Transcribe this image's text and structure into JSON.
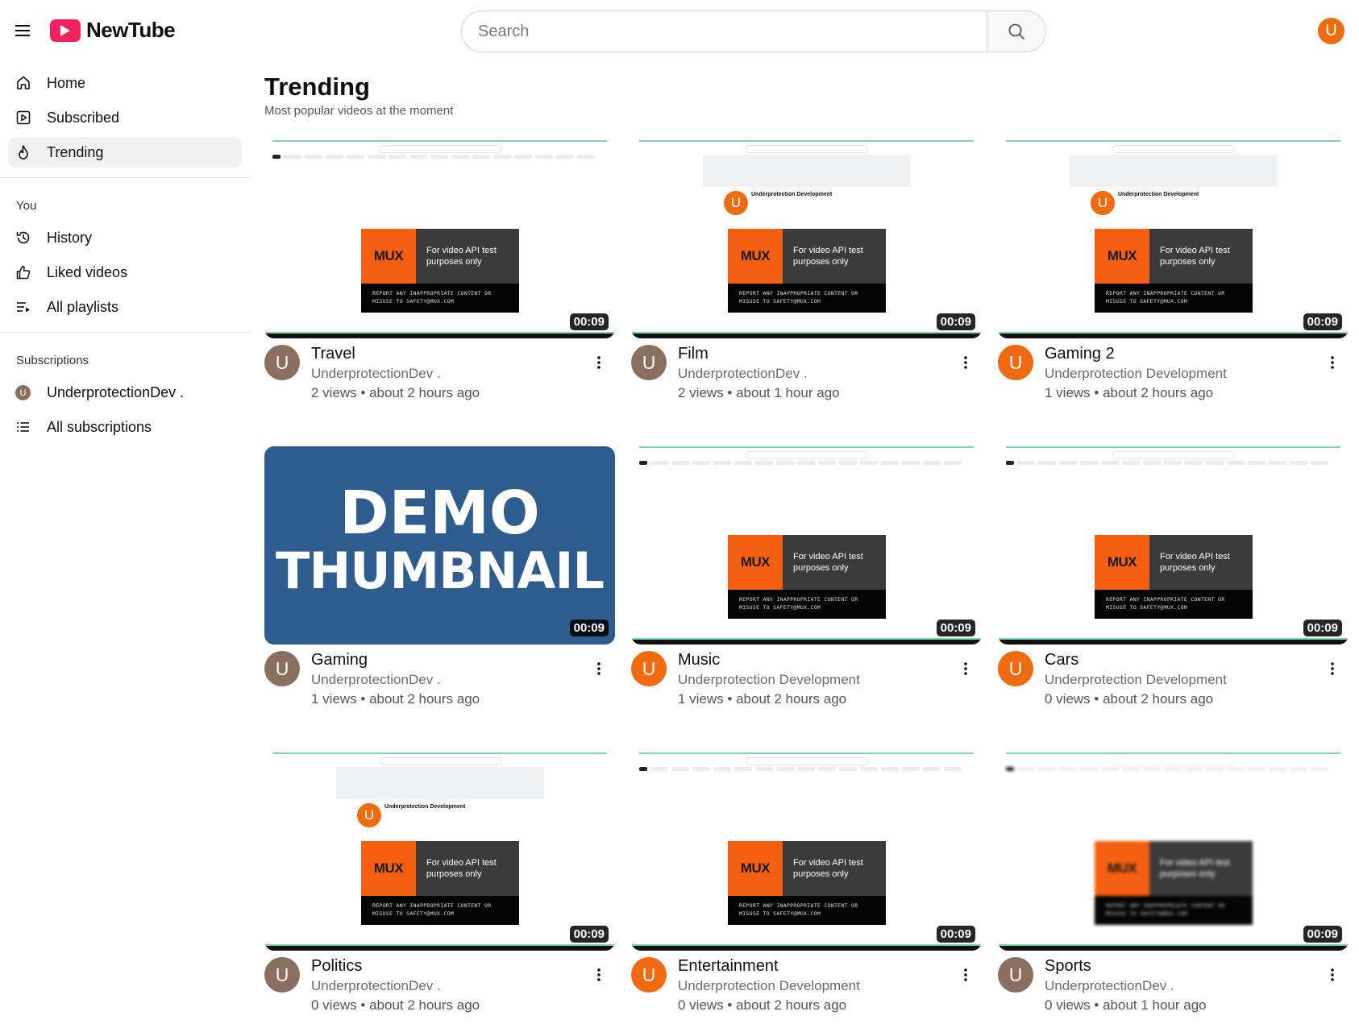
{
  "app": {
    "name": "NewTube"
  },
  "search": {
    "placeholder": "Search"
  },
  "user": {
    "avatar_letter": "U"
  },
  "sidebar": {
    "main": [
      {
        "label": "Home",
        "icon": "home-icon",
        "active": false
      },
      {
        "label": "Subscribed",
        "icon": "play-square-icon",
        "active": false
      },
      {
        "label": "Trending",
        "icon": "flame-icon",
        "active": true
      }
    ],
    "you_title": "You",
    "you": [
      {
        "label": "History",
        "icon": "history-icon"
      },
      {
        "label": "Liked videos",
        "icon": "thumbs-up-icon"
      },
      {
        "label": "All playlists",
        "icon": "playlist-icon"
      }
    ],
    "subs_title": "Subscriptions",
    "subs": [
      {
        "label": "UnderprotectionDev .",
        "avatar_letter": "U"
      },
      {
        "label": "All subscriptions",
        "icon": "list-icon"
      }
    ]
  },
  "page": {
    "title": "Trending",
    "subtitle": "Most popular videos at the moment"
  },
  "thumb_text": {
    "search": "Search",
    "channel": "Underprotection Development",
    "mux_logo": "MUX",
    "mux_line1": "For video API test",
    "mux_line2": "purposes only",
    "mux_warn1": "REPORT ANY INAPPROPRIATE CONTENT OR",
    "mux_warn2": "MISUSE TO SAFETY@MUX.COM",
    "demo_line1": "DEMO",
    "demo_line2": "THUMBNAIL"
  },
  "colors": {
    "accent": "#f0215c",
    "orange_avatar": "#f06a0f",
    "brown_avatar": "#8a6e5f",
    "demo_bg": "#2f5c8e",
    "mux_orange": "#f65f11"
  },
  "videos": [
    {
      "title": "Travel",
      "channel": "UnderprotectionDev .",
      "stats": "2 views • about 2 hours ago",
      "duration": "00:09",
      "avatar_letter": "U",
      "avatar_color": "brown",
      "thumb": "feed"
    },
    {
      "title": "Film",
      "channel": "UnderprotectionDev .",
      "stats": "2 views • about 1 hour ago",
      "duration": "00:09",
      "avatar_letter": "U",
      "avatar_color": "brown",
      "thumb": "channel"
    },
    {
      "title": "Gaming 2",
      "channel": "Underprotection Development",
      "stats": "1 views • about 2 hours ago",
      "duration": "00:09",
      "avatar_letter": "U",
      "avatar_color": "orange",
      "thumb": "channel"
    },
    {
      "title": "Gaming",
      "channel": "UnderprotectionDev .",
      "stats": "1 views • about 2 hours ago",
      "duration": "00:09",
      "avatar_letter": "U",
      "avatar_color": "brown",
      "thumb": "demo"
    },
    {
      "title": "Music",
      "channel": "Underprotection Development",
      "stats": "1 views • about 2 hours ago",
      "duration": "00:09",
      "avatar_letter": "U",
      "avatar_color": "orange",
      "thumb": "feed"
    },
    {
      "title": "Cars",
      "channel": "Underprotection Development",
      "stats": "0 views • about 2 hours ago",
      "duration": "00:09",
      "avatar_letter": "U",
      "avatar_color": "orange",
      "thumb": "feed"
    },
    {
      "title": "Politics",
      "channel": "UnderprotectionDev .",
      "stats": "0 views • about 2 hours ago",
      "duration": "00:09",
      "avatar_letter": "U",
      "avatar_color": "brown",
      "thumb": "channel"
    },
    {
      "title": "Entertainment",
      "channel": "Underprotection Development",
      "stats": "0 views • about 2 hours ago",
      "duration": "00:09",
      "avatar_letter": "U",
      "avatar_color": "orange",
      "thumb": "feed"
    },
    {
      "title": "Sports",
      "channel": "UnderprotectionDev .",
      "stats": "0 views • about 1 hour ago",
      "duration": "00:09",
      "avatar_letter": "U",
      "avatar_color": "brown",
      "thumb": "blurred"
    }
  ]
}
